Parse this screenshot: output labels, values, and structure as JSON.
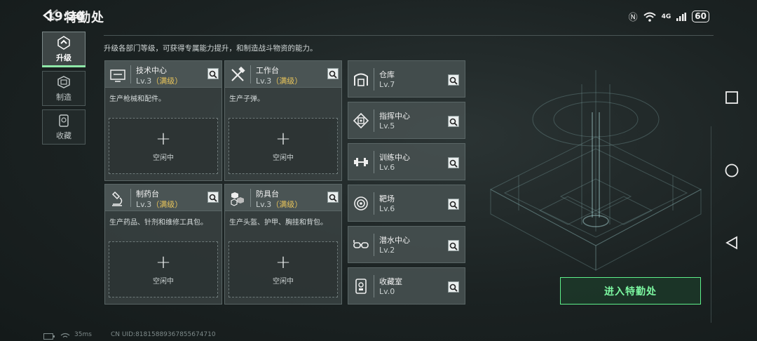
{
  "status_bar": {
    "time": "19:20",
    "network": "4G",
    "battery": "60"
  },
  "header": {
    "title": "特勤处"
  },
  "tabs": [
    {
      "label": "升级",
      "icon": "upgrade-icon",
      "active": true
    },
    {
      "label": "制造",
      "icon": "factory-icon",
      "active": false
    },
    {
      "label": "收藏",
      "icon": "collection-icon",
      "active": false
    }
  ],
  "description": "升级各部门等级，可获得专属能力提升，和制造战斗物资的能力。",
  "departments": [
    {
      "name": "技术中心",
      "level": "Lv.3",
      "max_tag": "（满级）",
      "desc": "生产枪械和配件。",
      "slot_label": "空闲中",
      "icon": "monitor-icon"
    },
    {
      "name": "工作台",
      "level": "Lv.3",
      "max_tag": "（满级）",
      "desc": "生产子弹。",
      "slot_label": "空闲中",
      "icon": "tools-icon"
    },
    {
      "name": "制药台",
      "level": "Lv.3",
      "max_tag": "（满级）",
      "desc": "生产药品、针剂和维修工具包。",
      "slot_label": "空闲中",
      "icon": "microscope-icon"
    },
    {
      "name": "防具台",
      "level": "Lv.3",
      "max_tag": "（满级）",
      "desc": "生产头盔、护甲、胸挂和背包。",
      "slot_label": "空闲中",
      "icon": "armor-icon"
    }
  ],
  "facilities": [
    {
      "name": "仓库",
      "level": "Lv.7",
      "icon": "warehouse-icon"
    },
    {
      "name": "指挥中心",
      "level": "Lv.5",
      "icon": "chip-icon"
    },
    {
      "name": "训练中心",
      "level": "Lv.6",
      "icon": "dumbbell-icon"
    },
    {
      "name": "靶场",
      "level": "Lv.6",
      "icon": "target-icon"
    },
    {
      "name": "潜水中心",
      "level": "Lv.2",
      "icon": "goggles-icon"
    },
    {
      "name": "收藏室",
      "level": "Lv.0",
      "icon": "trophy-icon"
    }
  ],
  "enter_button": "进入特勤处",
  "footer": {
    "ping": "35ms",
    "uid": "CN UID:81815889367855674710"
  },
  "colors": {
    "accent_green": "#5ef08a",
    "max_gold": "#e8c45a",
    "panel": "#3a4242"
  }
}
